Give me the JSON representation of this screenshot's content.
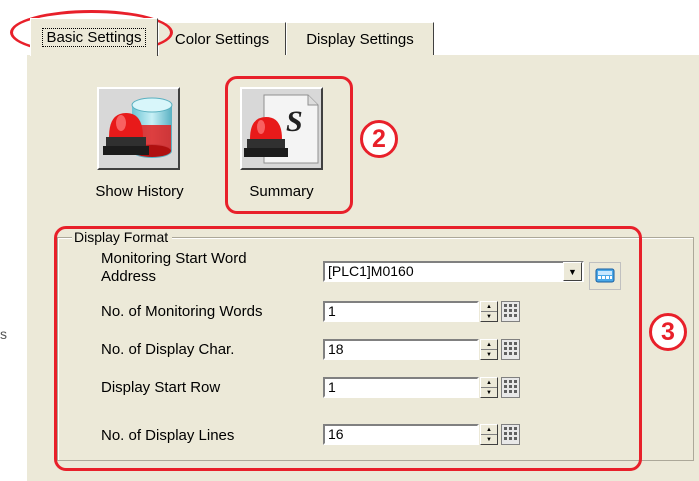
{
  "tabs": [
    {
      "label": "Basic Settings",
      "active": true
    },
    {
      "label": "Color Settings",
      "active": false
    },
    {
      "label": "Display Settings",
      "active": false
    }
  ],
  "icons": [
    {
      "label": "Show History",
      "icon": "alarm-history-icon"
    },
    {
      "label": "Summary",
      "icon": "alarm-summary-icon"
    }
  ],
  "display_format": {
    "legend": "Display Format",
    "monitoring_start_label_line1": "Monitoring Start Word",
    "monitoring_start_label_line2": "Address",
    "monitoring_start_value": "[PLC1]M0160",
    "rows": [
      {
        "label": "No. of Monitoring Words",
        "value": "1"
      },
      {
        "label": "No. of Display Char.",
        "value": "18"
      },
      {
        "label": "Display Start Row",
        "value": "1"
      },
      {
        "label": "No. of Display Lines",
        "value": "16"
      }
    ]
  },
  "annotations": {
    "badge_2": "2",
    "badge_3": "3"
  },
  "stray_char": "s",
  "colors": {
    "annotation_red": "#e8202a",
    "panel_bg": "#ece9d8"
  }
}
